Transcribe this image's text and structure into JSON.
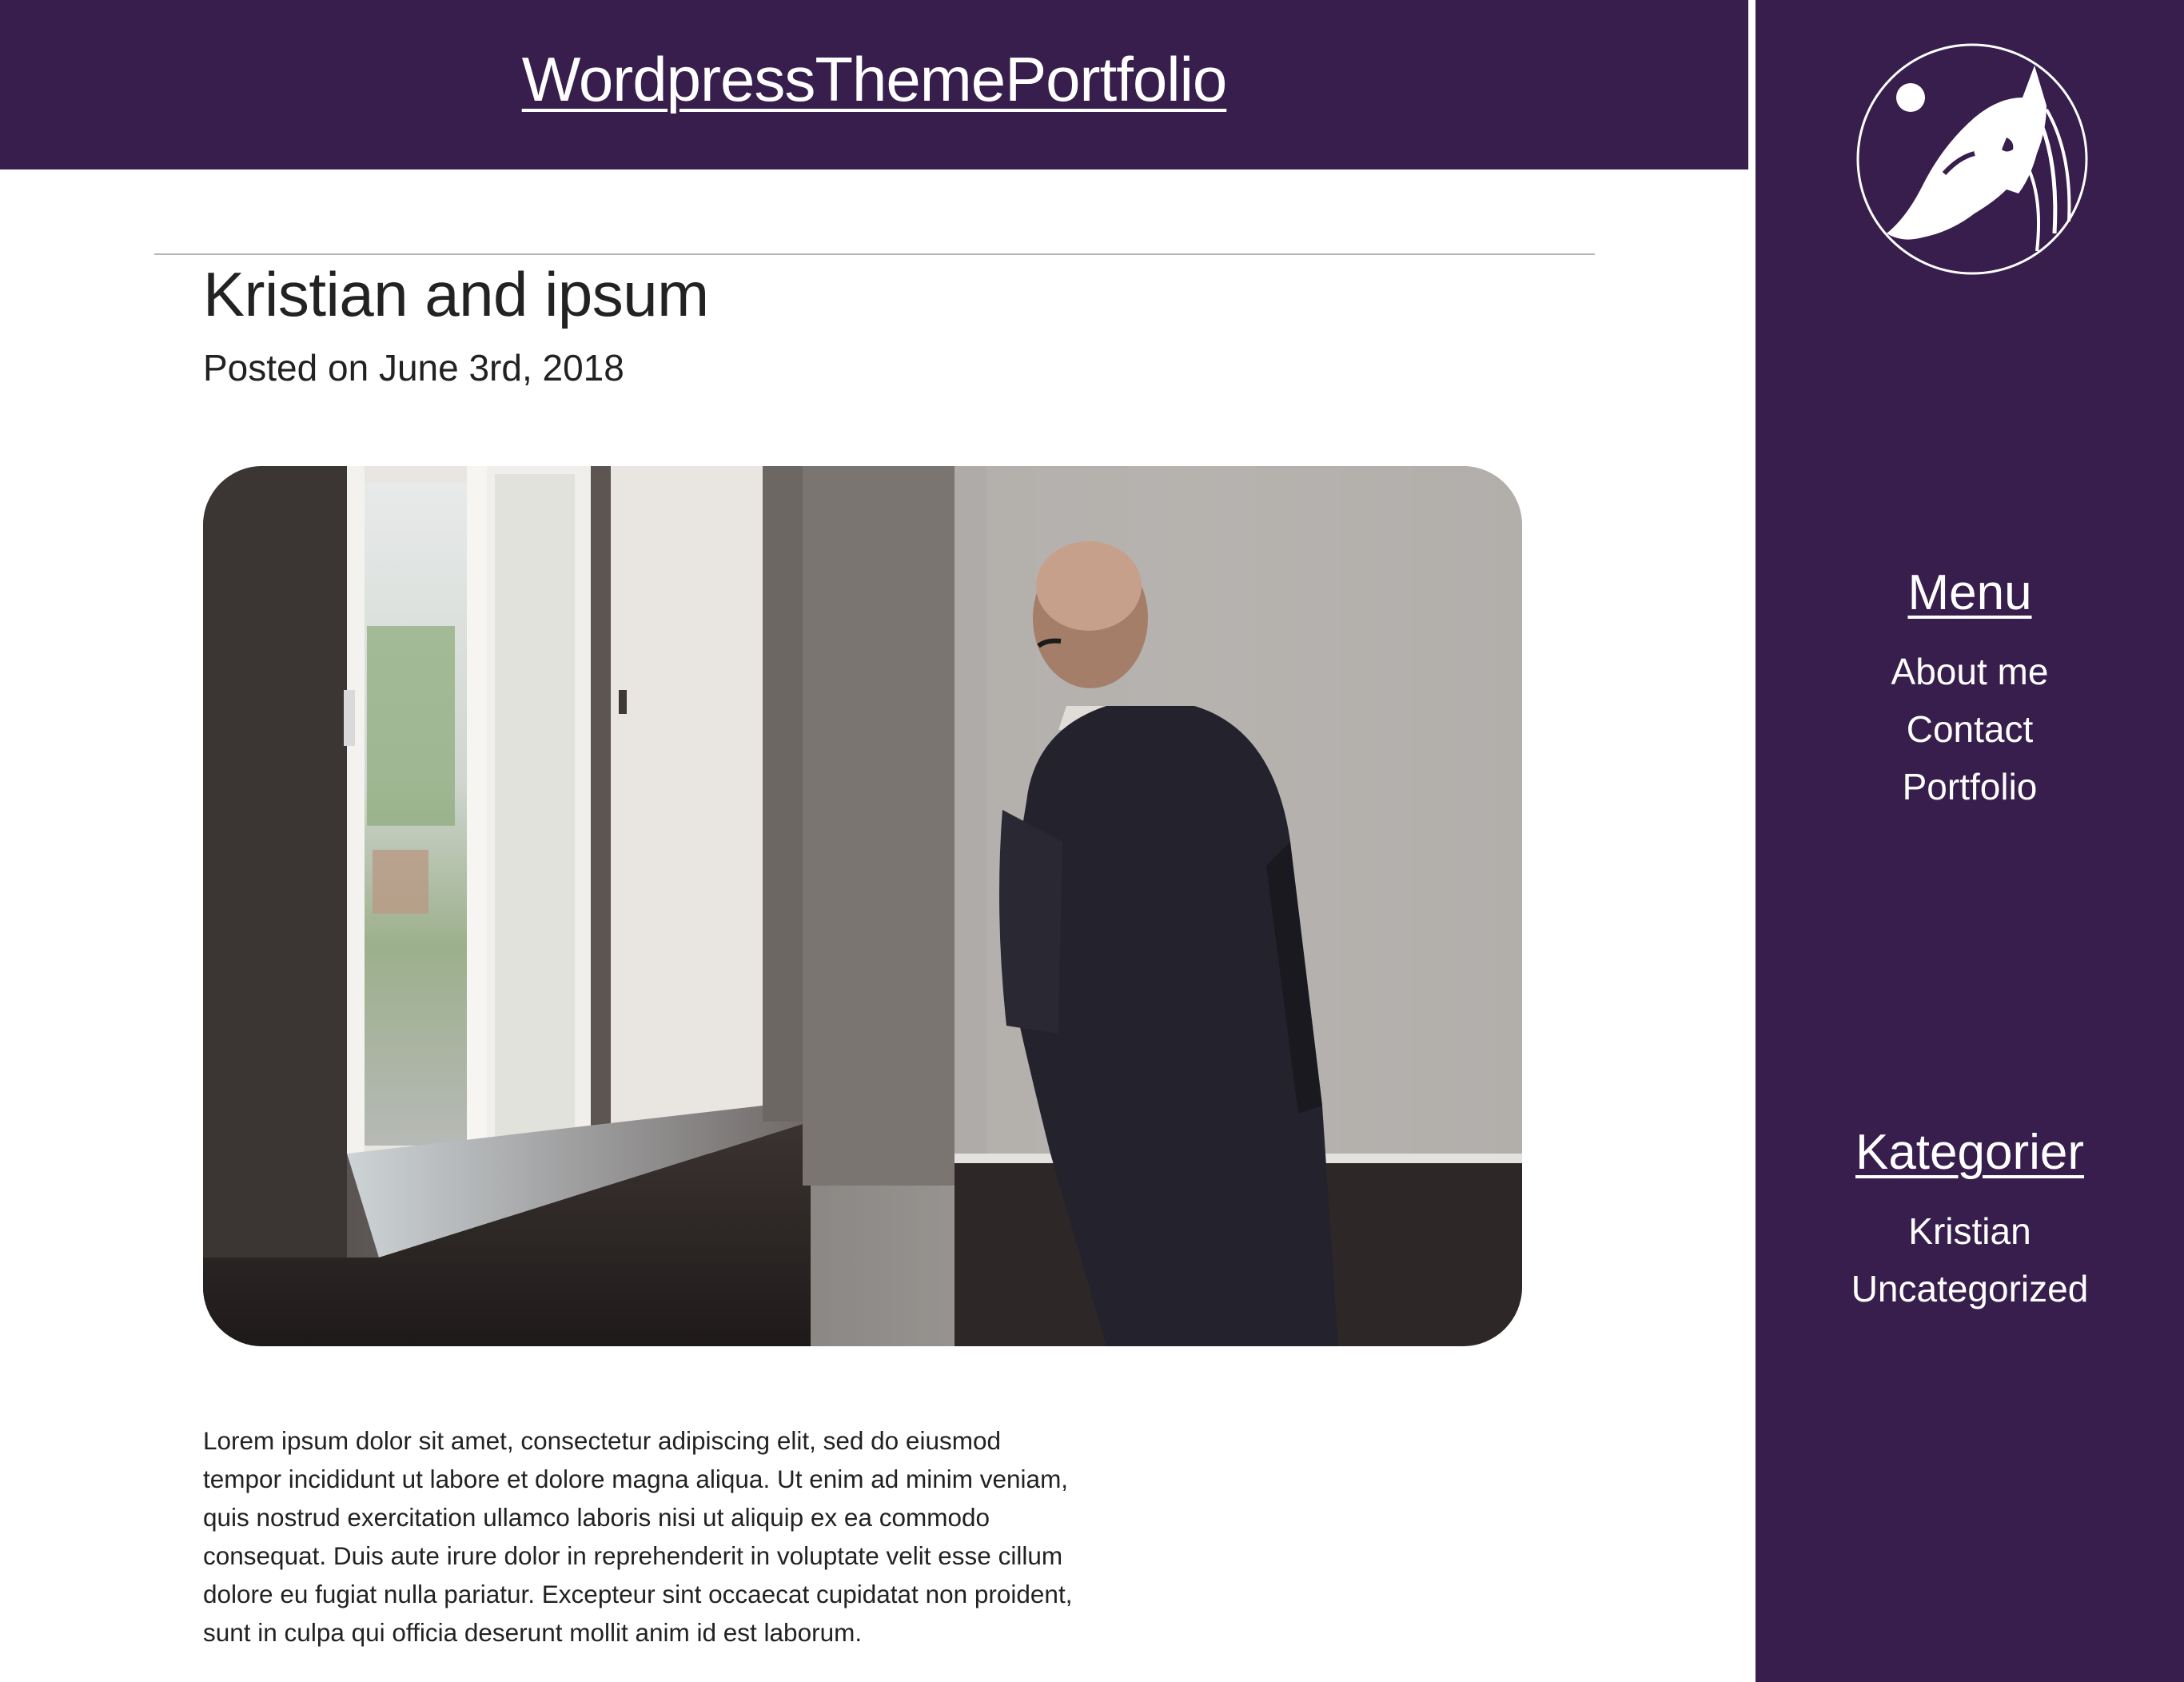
{
  "header": {
    "site_title": "WordpressThemePortfolio"
  },
  "post": {
    "title": "Kristian and ipsum",
    "date": "Posted on June 3rd, 2018",
    "body": "Lorem ipsum dolor sit amet, consectetur adipiscing elit, sed do eiusmod tempor incididunt ut labore et dolore magna aliqua. Ut enim ad minim veniam, quis nostrud exercitation ullamco laboris nisi ut aliquip ex ea commodo consequat. Duis aute irure dolor in reprehenderit in voluptate velit esse cillum dolore eu fugiat nulla pariatur. Excepteur sint occaecat cupidatat non proident, sunt in culpa qui officia deserunt mollit anim id est laborum."
  },
  "sidebar": {
    "logo_icon": "horse-head-logo-icon",
    "menu": {
      "heading": "Menu",
      "items": [
        {
          "label": "About me"
        },
        {
          "label": "Contact"
        },
        {
          "label": "Portfolio"
        }
      ]
    },
    "categories": {
      "heading": "Kategorier",
      "items": [
        {
          "label": "Kristian"
        },
        {
          "label": "Uncategorized"
        }
      ]
    }
  },
  "colors": {
    "brand_purple": "#371e4d",
    "text": "#222222",
    "divider": "#b5b5b5"
  }
}
